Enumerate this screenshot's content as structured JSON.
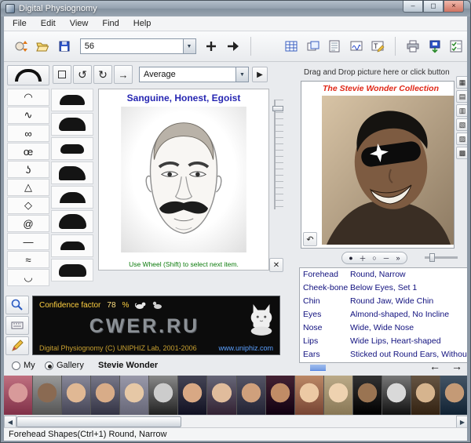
{
  "window": {
    "title": "Digital Physiognomy"
  },
  "menu": {
    "items": [
      "File",
      "Edit",
      "View",
      "Find",
      "Help"
    ]
  },
  "toolbar": {
    "count_value": "56",
    "icons": [
      "orientation",
      "open",
      "save",
      "count-combo",
      "add",
      "apply",
      "table-view",
      "card-view",
      "list-view",
      "signature",
      "type-tool",
      "print",
      "export",
      "checklist"
    ]
  },
  "editor": {
    "style_value": "Average",
    "personality": "Sanguine, Honest, Egoist",
    "wheel_hint": "Use Wheel (Shift) to select next item."
  },
  "left_panel": {
    "feature_buttons": [
      {
        "name": "feature-forehead-arc",
        "glyph": "◠"
      },
      {
        "name": "feature-eyebrow",
        "glyph": "∿"
      },
      {
        "name": "feature-glasses",
        "glyph": "∞"
      },
      {
        "name": "feature-eyes",
        "glyph": "œ"
      },
      {
        "name": "feature-nose",
        "glyph": "ʖ"
      },
      {
        "name": "feature-triangle",
        "glyph": "△"
      },
      {
        "name": "feature-diamond",
        "glyph": "◇"
      },
      {
        "name": "feature-ear",
        "glyph": "@"
      },
      {
        "name": "feature-mouth-line",
        "glyph": "—"
      },
      {
        "name": "feature-lips",
        "glyph": "≈"
      },
      {
        "name": "feature-chin",
        "glyph": "◡"
      }
    ],
    "hair_styles_count": 8
  },
  "photo_panel": {
    "drop_hint": "Drag and Drop picture here or click button",
    "caption": "The Stevie Wonder Collection",
    "side_button_count": 6,
    "zoom_icons": [
      "pan",
      "zoom-in",
      "actual-size",
      "zoom-out",
      "more"
    ],
    "features": [
      {
        "label": "Forehead",
        "value": "Round, Narrow"
      },
      {
        "label": "Cheek-bone",
        "value": "Below Eyes, Set 1"
      },
      {
        "label": "Chin",
        "value": "Round Jaw, Wide Chin"
      },
      {
        "label": "Eyes",
        "value": "Almond-shaped, No Incline"
      },
      {
        "label": "Nose",
        "value": "Wide, Wide Nose"
      },
      {
        "label": "Lips",
        "value": "Wide Lips, Heart-shaped"
      },
      {
        "label": "Ears",
        "value": "Sticked out Round Ears, Without Lobe"
      }
    ]
  },
  "confidence": {
    "label": "Confidence factor",
    "value": "78",
    "unit": "%",
    "watermark": "CWER.RU",
    "copyright": "Digital Physiognomy (C) UNIPHIZ Lab, 2001-2006",
    "website": "www.uniphiz.com"
  },
  "gallery": {
    "my_label": "My",
    "gallery_label": "Gallery",
    "selected": "gallery",
    "current_name": "Stevie Wonder",
    "thumbs": [
      {
        "face": "#d89a9a",
        "bg1": "#c07080",
        "bg2": "#803048"
      },
      {
        "face": "#8a6a52",
        "bg1": "#999999",
        "bg2": "#555555"
      },
      {
        "face": "#e0b894",
        "bg1": "#888899",
        "bg2": "#444455"
      },
      {
        "face": "#d8ac88",
        "bg1": "#777788",
        "bg2": "#333344"
      },
      {
        "face": "#e6c8a6",
        "bg1": "#9999aa",
        "bg2": "#666677"
      },
      {
        "face": "#cccccc",
        "bg1": "#888888",
        "bg2": "#222222"
      },
      {
        "face": "#d8a884",
        "bg1": "#444455",
        "bg2": "#111122"
      },
      {
        "face": "#e0bc9c",
        "bg1": "#666677",
        "bg2": "#332233"
      },
      {
        "face": "#cfa07c",
        "bg1": "#555566",
        "bg2": "#222233"
      },
      {
        "face": "#c08c66",
        "bg1": "#442233",
        "bg2": "#110011"
      },
      {
        "face": "#ecc9a4",
        "bg1": "#bb8866",
        "bg2": "#774433"
      },
      {
        "face": "#eed2b0",
        "bg1": "#bbaa88",
        "bg2": "#887755"
      },
      {
        "face": "#9a7452",
        "bg1": "#333333",
        "bg2": "#000000"
      },
      {
        "face": "#d9d9d9",
        "bg1": "#777777",
        "bg2": "#111111"
      },
      {
        "face": "#d6b48e",
        "bg1": "#665544",
        "bg2": "#332211"
      },
      {
        "face": "#c49a76",
        "bg1": "#445566",
        "bg2": "#112233"
      }
    ]
  },
  "status": {
    "text": "Forehead Shapes(Ctrl+1) Round, Narrow"
  },
  "colors": {
    "personality_blue": "#2626b2",
    "feature_navy": "#10107e",
    "hint_green": "#0a7a0a",
    "caption_red": "#e02818",
    "confidence_yellow": "#ffd040",
    "link_blue": "#5aa0ff"
  }
}
